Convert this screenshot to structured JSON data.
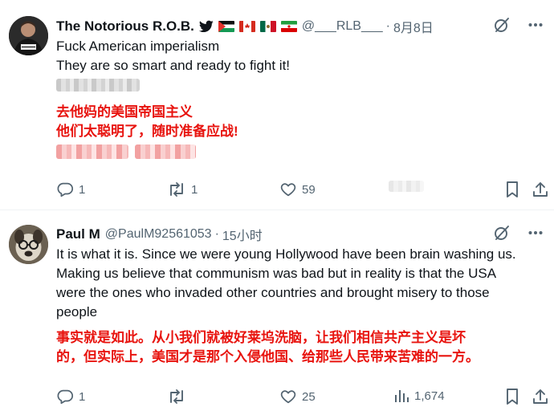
{
  "tweets": [
    {
      "name": "The Notorious R.O.B.",
      "handle": "@___RLB___",
      "separator": "·",
      "time": "8月8日",
      "text_lines": [
        "Fuck American imperialism",
        "They are so smart and ready to fight it!"
      ],
      "translation_lines": [
        "去他妈的美国帝国主义",
        "他们太聪明了，随时准备应战!"
      ],
      "replies": "1",
      "retweets": "1",
      "likes": "59",
      "views": ""
    },
    {
      "name": "Paul M",
      "handle": "@PaulM92561053",
      "separator": "·",
      "time": "15小时",
      "text_lines": [
        "It is what it is.  Since we were young Hollywood have been brain washing us.",
        "Making us believe that communism was bad but in reality is that the USA",
        "were the ones who invaded other countries and brought misery to those",
        "people"
      ],
      "translation_lines": [
        "事实就是如此。从小我们就被好莱坞洗脑，让我们相信共产主义是坏",
        "的，但实际上，美国才是那个入侵他国、给那些人民带来苦难的一方。"
      ],
      "replies": "1",
      "retweets": "",
      "likes": "25",
      "views": "1,674"
    }
  ],
  "icons": {
    "more": "more-horizontal-icon",
    "grok": "grok-slash-circle-icon",
    "reply": "reply-bubble-icon",
    "retweet": "retweet-arrows-icon",
    "like": "heart-icon",
    "views": "views-bars-icon",
    "bookmark": "bookmark-icon",
    "share": "share-upload-icon",
    "verified_bird": "twitter-bird-icon"
  },
  "colors": {
    "text": "#0f1419",
    "secondary": "#536471",
    "translation": "#e8140f",
    "divider": "#eff3f4"
  }
}
